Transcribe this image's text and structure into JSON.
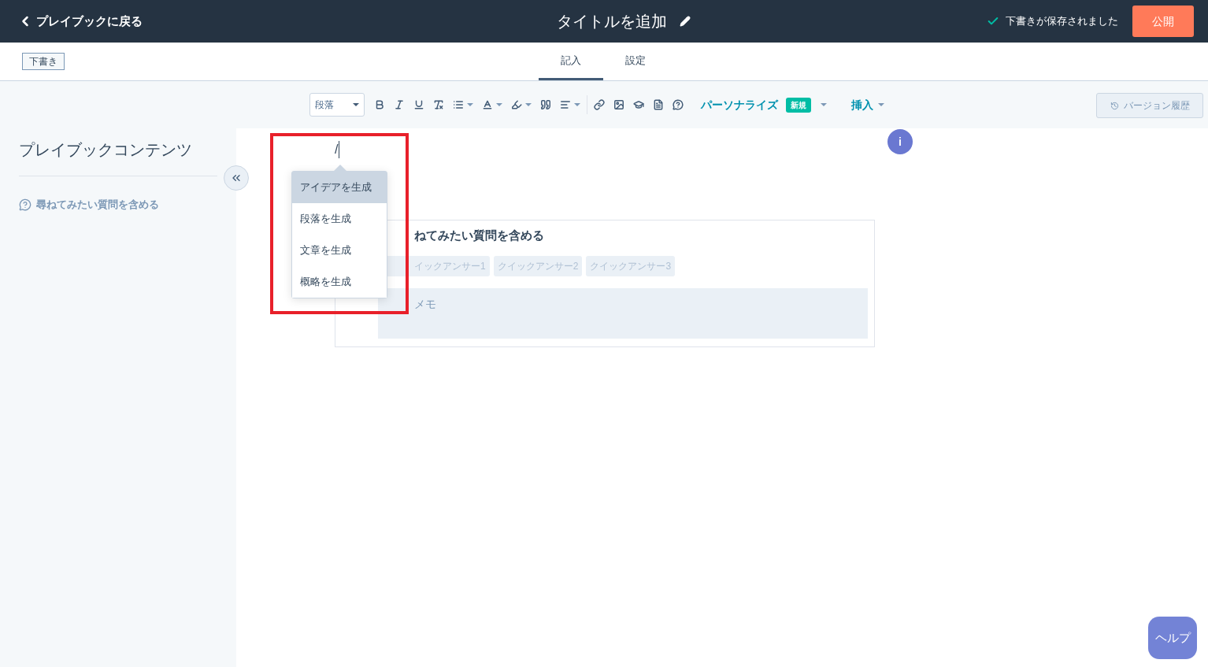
{
  "header": {
    "back_link": "プレイブックに戻る",
    "title": "タイトルを追加",
    "save_status": "下書きが保存されました",
    "publish_button": "公開"
  },
  "subheader": {
    "status_badge": "下書き",
    "tabs": [
      {
        "label": "記入",
        "selected": true
      },
      {
        "label": "設定",
        "selected": false
      }
    ]
  },
  "toolbar": {
    "block_style": "段落",
    "personalize": "パーソナライズ",
    "new_badge": "新規",
    "insert": "挿入",
    "version_history": "バージョン履歴"
  },
  "sidebar": {
    "title": "プレイブックコンテンツ",
    "items": [
      {
        "label": "尋ねてみたい質問を含める"
      }
    ]
  },
  "editor": {
    "typed_text": "/",
    "info_badge": "i",
    "menu": [
      {
        "label": "アイデアを生成",
        "selected": true
      },
      {
        "label": "段落を生成",
        "selected": false
      },
      {
        "label": "文章を生成",
        "selected": false
      },
      {
        "label": "概略を生成",
        "selected": false
      }
    ],
    "card": {
      "title": "ねてみたい質問を含める",
      "quick_answers": [
        "イックアンサー1",
        "クイックアンサー2",
        "クイックアンサー3"
      ],
      "memo_placeholder": "メモ"
    }
  },
  "help_button": "ヘルプ"
}
